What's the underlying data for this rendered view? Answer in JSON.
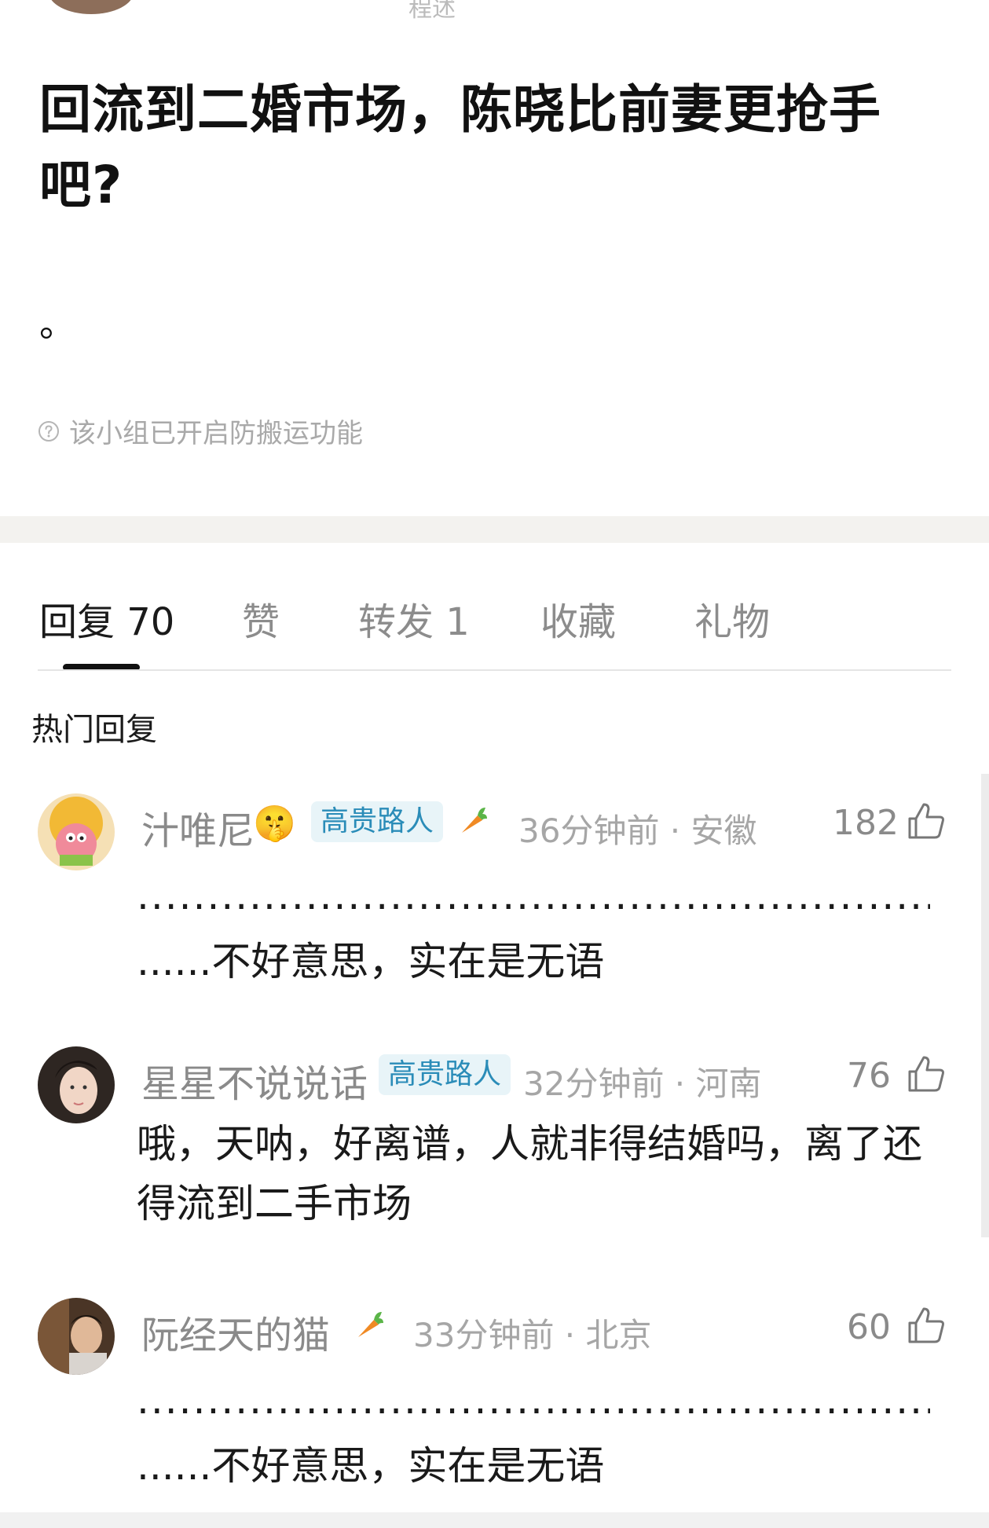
{
  "header": {
    "author_name": "程述"
  },
  "post": {
    "title": "回流到二婚市场，陈晓比前妻更抢手吧?",
    "body": "。",
    "anti_copy_note": "该小组已开启防搬运功能"
  },
  "tabs": [
    {
      "label": "回复 70",
      "active": true
    },
    {
      "label": "赞",
      "active": false
    },
    {
      "label": "转发 1",
      "active": false
    },
    {
      "label": "收藏",
      "active": false
    },
    {
      "label": "礼物",
      "active": false
    }
  ],
  "hot_replies_title": "热门回复",
  "comments": [
    {
      "name": "汁唯尼",
      "emoji": "🤫",
      "tag": "高贵路人",
      "has_carrot": true,
      "meta": "36分钟前 · 安徽",
      "likes": "182",
      "text_line1": ".................................................................",
      "text_line2": "......不好意思，实在是无语",
      "avatar_color": "#f2c46a"
    },
    {
      "name": "星星不说说话",
      "tag": "高贵路人",
      "meta": "32分钟前 · 河南",
      "likes": "76",
      "text": "哦，天呐，好离谱，人就非得结婚吗，离了还得流到二手市场",
      "avatar_color": "#3a2f2a"
    },
    {
      "name": "阮经天的猫",
      "has_carrot": true,
      "meta": "33分钟前 · 北京",
      "likes": "60",
      "text_line1": ".................................................................",
      "text_line2": "......不好意思，实在是无语",
      "avatar_color": "#5a4030"
    }
  ]
}
